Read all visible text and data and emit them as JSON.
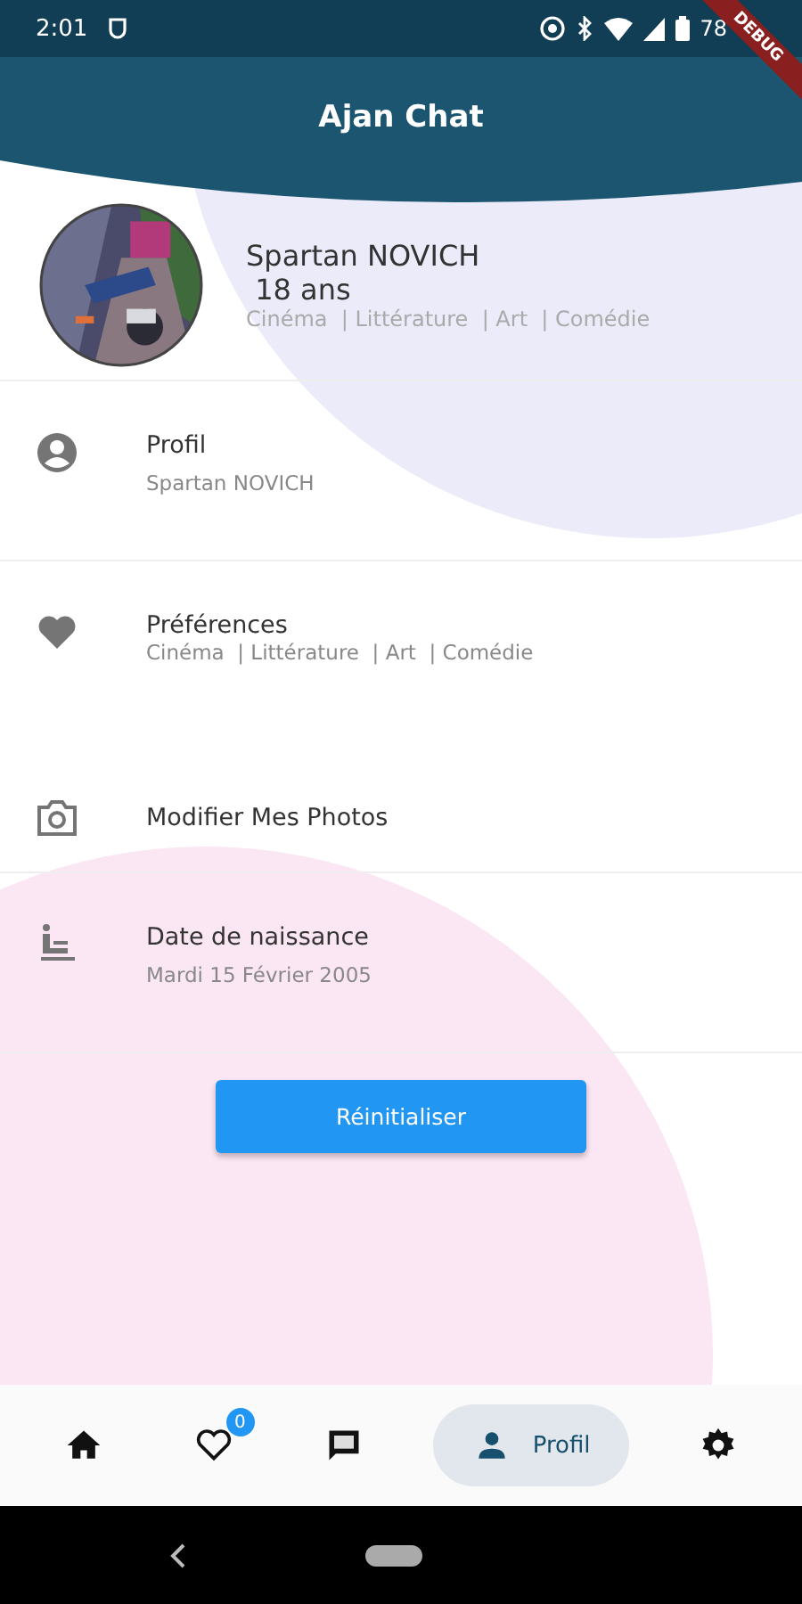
{
  "status_bar": {
    "time": "2:01",
    "battery": "78"
  },
  "debug_banner": "DEBUG",
  "app_bar": {
    "title": "Ajan Chat"
  },
  "profile_card": {
    "name": "Spartan NOVICH",
    "age": " 18 ans",
    "interests": "Cinéma  | Littérature  | Art  | Comédie"
  },
  "settings": [
    {
      "kind": "person",
      "title": "Profil",
      "subtitle": "Spartan NOVICH"
    },
    {
      "kind": "heart",
      "title": "Préférences",
      "subtitle": "Cinéma  | Littérature  | Art  | Comédie"
    },
    {
      "kind": "camera",
      "title": "Modifier Mes Photos"
    },
    {
      "kind": "birthday",
      "title": "Date de naissance",
      "subtitle": "Mardi 15 Février 2005"
    }
  ],
  "reset_button": "Réinitialiser",
  "bottom_nav": [
    {
      "kind": "home",
      "selected": false
    },
    {
      "kind": "heart",
      "selected": false,
      "badge": "0"
    },
    {
      "kind": "chat",
      "selected": false
    },
    {
      "kind": "person",
      "selected": true,
      "label": "Profil"
    },
    {
      "kind": "settings",
      "selected": false
    }
  ]
}
